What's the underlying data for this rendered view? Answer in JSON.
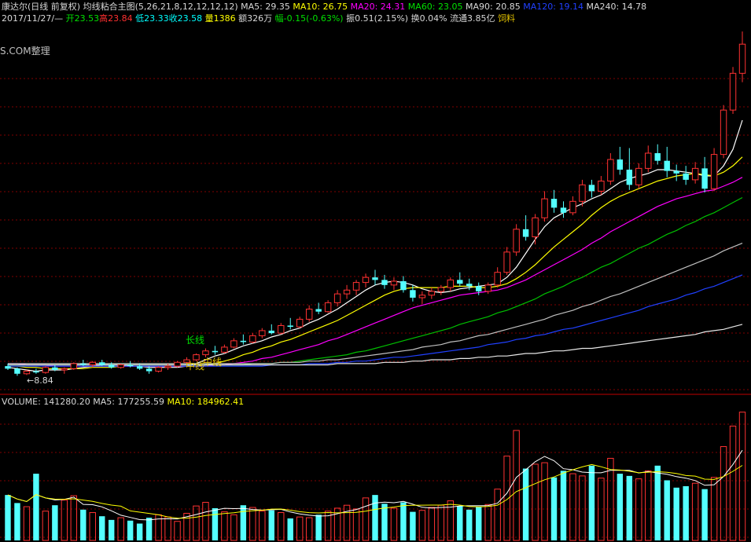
{
  "header": {
    "stock_name": "康达尔(日线 前复权)",
    "indicator": "均线粘合主图(5,26,21,8,12,12,12,12)",
    "ma5": "MA5: 29.35",
    "ma10": "MA10: 26.75",
    "ma20": "MA20: 24.31",
    "ma60": "MA60: 23.05",
    "ma90": "MA90: 20.85",
    "ma120": "MA120: 19.14",
    "ma240": "MA240: 14.78"
  },
  "quote": {
    "date": "2017/11/27/—",
    "open": "开23.53",
    "high": "高23.84",
    "low": "低23.33",
    "close": "收23.58",
    "volume": "量1386",
    "amount": "额326万",
    "change": "幅-0.15(-0.63%)",
    "amplitude": "振0.51(2.15%)",
    "turnover": "换0.04%",
    "float_cap": "流通3.85亿",
    "sector": "饲料"
  },
  "watermark": "S.COM整理",
  "annotations": {
    "long_line": "长线",
    "mid_line_1": "中线",
    "mid_line_2": "中线",
    "low_marker": "←8.84"
  },
  "volume_header": {
    "volume": "VOLUME: 141280.20",
    "ma5": "MA5: 177255.59",
    "ma10": "MA10: 184962.41"
  },
  "colors": {
    "background": "#000000",
    "up": "#ff3232",
    "down": "#54ffff",
    "ma5": "#ffffff",
    "ma10": "#ffff00",
    "ma20": "#ff00ff",
    "ma60": "#00c000",
    "ma90": "#c0c0c0",
    "ma120": "#2040ff",
    "ma240": "#e8e8e8",
    "grid": "#800000"
  },
  "chart_data": {
    "type": "candlestick",
    "ylim": [
      7.5,
      36.5
    ],
    "candles": [
      [
        9.6,
        9.8,
        9.3,
        9.4
      ],
      [
        9.4,
        9.5,
        8.84,
        9.0
      ],
      [
        9.0,
        9.3,
        8.9,
        9.2
      ],
      [
        9.2,
        9.4,
        9.0,
        9.1
      ],
      [
        9.1,
        9.6,
        9.0,
        9.5
      ],
      [
        9.5,
        9.7,
        9.2,
        9.3
      ],
      [
        9.3,
        9.5,
        9.0,
        9.4
      ],
      [
        9.4,
        9.9,
        9.3,
        9.8
      ],
      [
        9.8,
        10.1,
        9.6,
        9.7
      ],
      [
        9.7,
        10.0,
        9.5,
        9.9
      ],
      [
        9.9,
        10.1,
        9.6,
        9.7
      ],
      [
        9.7,
        9.9,
        9.4,
        9.5
      ],
      [
        9.5,
        9.8,
        9.4,
        9.7
      ],
      [
        9.7,
        10.0,
        9.5,
        9.6
      ],
      [
        9.6,
        9.8,
        9.3,
        9.4
      ],
      [
        9.4,
        9.6,
        9.0,
        9.2
      ],
      [
        9.2,
        9.6,
        9.1,
        9.5
      ],
      [
        9.5,
        9.8,
        9.3,
        9.6
      ],
      [
        9.6,
        10.0,
        9.5,
        9.9
      ],
      [
        9.9,
        10.3,
        9.7,
        10.1
      ],
      [
        10.1,
        10.6,
        10.0,
        10.5
      ],
      [
        10.5,
        11.0,
        10.3,
        10.8
      ],
      [
        10.8,
        11.2,
        10.5,
        10.7
      ],
      [
        10.7,
        11.3,
        10.6,
        11.1
      ],
      [
        11.1,
        11.8,
        11.0,
        11.6
      ],
      [
        11.6,
        12.1,
        11.3,
        11.5
      ],
      [
        11.5,
        12.2,
        11.4,
        12.0
      ],
      [
        12.0,
        12.6,
        11.8,
        12.4
      ],
      [
        12.4,
        12.9,
        12.1,
        12.2
      ],
      [
        12.2,
        13.0,
        12.1,
        12.8
      ],
      [
        12.8,
        13.4,
        12.5,
        12.7
      ],
      [
        12.7,
        13.5,
        12.6,
        13.3
      ],
      [
        13.3,
        14.4,
        13.1,
        14.1
      ],
      [
        14.1,
        14.6,
        13.7,
        13.9
      ],
      [
        13.9,
        14.8,
        13.8,
        14.6
      ],
      [
        14.6,
        15.6,
        14.3,
        15.3
      ],
      [
        15.3,
        16.0,
        14.9,
        15.6
      ],
      [
        15.6,
        16.4,
        15.2,
        16.2
      ],
      [
        16.2,
        16.9,
        15.8,
        16.6
      ],
      [
        16.6,
        17.2,
        16.0,
        16.4
      ],
      [
        16.4,
        16.8,
        15.7,
        16.0
      ],
      [
        16.0,
        16.6,
        15.6,
        16.3
      ],
      [
        16.3,
        16.7,
        15.4,
        15.6
      ],
      [
        15.6,
        16.0,
        14.7,
        15.0
      ],
      [
        15.0,
        15.5,
        14.5,
        15.2
      ],
      [
        15.2,
        15.8,
        14.9,
        15.5
      ],
      [
        15.5,
        16.0,
        15.2,
        15.8
      ],
      [
        15.8,
        16.6,
        15.5,
        16.4
      ],
      [
        16.4,
        17.0,
        15.9,
        16.1
      ],
      [
        16.1,
        16.5,
        15.6,
        15.9
      ],
      [
        15.9,
        16.2,
        15.2,
        15.5
      ],
      [
        15.5,
        16.2,
        15.3,
        16.0
      ],
      [
        16.0,
        17.4,
        15.8,
        17.0
      ],
      [
        17.0,
        19.0,
        16.8,
        18.6
      ],
      [
        18.6,
        20.8,
        18.3,
        20.4
      ],
      [
        20.4,
        21.5,
        19.5,
        19.8
      ],
      [
        19.8,
        21.6,
        19.2,
        21.3
      ],
      [
        21.3,
        23.4,
        21.0,
        22.8
      ],
      [
        22.8,
        23.5,
        21.7,
        22.1
      ],
      [
        22.1,
        22.6,
        21.3,
        21.7
      ],
      [
        21.7,
        23.0,
        21.5,
        22.6
      ],
      [
        22.6,
        24.3,
        22.2,
        23.9
      ],
      [
        23.9,
        24.3,
        22.9,
        23.4
      ],
      [
        23.4,
        24.6,
        23.1,
        24.2
      ],
      [
        24.2,
        26.4,
        23.9,
        25.9
      ],
      [
        25.9,
        26.9,
        24.7,
        25.1
      ],
      [
        25.1,
        26.8,
        23.5,
        23.9
      ],
      [
        23.9,
        25.6,
        23.6,
        25.2
      ],
      [
        25.2,
        27.0,
        24.9,
        26.4
      ],
      [
        26.4,
        27.1,
        25.5,
        25.8
      ],
      [
        25.8,
        26.9,
        24.5,
        25.0
      ],
      [
        25.0,
        25.5,
        24.2,
        24.8
      ],
      [
        24.8,
        25.4,
        23.9,
        24.3
      ],
      [
        24.3,
        25.7,
        24.0,
        25.2
      ],
      [
        25.2,
        26.1,
        23.3,
        23.6
      ],
      [
        23.6,
        26.8,
        23.4,
        26.3
      ],
      [
        26.3,
        30.2,
        26.0,
        29.8
      ],
      [
        29.8,
        33.2,
        29.5,
        32.7
      ],
      [
        32.7,
        36.0,
        32.0,
        35.0
      ]
    ],
    "ma_lines": {
      "MA5": [
        9.5,
        9.4,
        9.3,
        9.2,
        9.3,
        9.3,
        9.3,
        9.4,
        9.5,
        9.6,
        9.7,
        9.7,
        9.7,
        9.6,
        9.6,
        9.5,
        9.5,
        9.5,
        9.5,
        9.6,
        9.8,
        10.1,
        10.4,
        10.6,
        10.9,
        11.2,
        11.4,
        11.6,
        11.9,
        12.1,
        12.4,
        12.6,
        13.0,
        13.3,
        13.7,
        14.1,
        14.6,
        15.1,
        15.6,
        16.0,
        16.2,
        16.3,
        16.2,
        16.0,
        15.7,
        15.5,
        15.4,
        15.5,
        15.7,
        15.8,
        15.9,
        16.0,
        16.1,
        16.6,
        17.4,
        18.5,
        19.6,
        20.6,
        21.3,
        21.7,
        22.1,
        22.4,
        22.8,
        23.1,
        23.6,
        24.1,
        24.4,
        24.6,
        24.8,
        25.1,
        25.1,
        25.0,
        24.9,
        24.8,
        24.6,
        24.6,
        25.4,
        26.7,
        29.0
      ],
      "MA10": [
        9.6,
        9.6,
        9.5,
        9.5,
        9.4,
        9.4,
        9.4,
        9.4,
        9.4,
        9.5,
        9.5,
        9.5,
        9.6,
        9.6,
        9.6,
        9.6,
        9.6,
        9.6,
        9.6,
        9.6,
        9.6,
        9.7,
        9.8,
        10.0,
        10.2,
        10.5,
        10.7,
        11.0,
        11.2,
        11.5,
        11.7,
        12.0,
        12.3,
        12.6,
        12.9,
        13.2,
        13.6,
        14.0,
        14.4,
        14.8,
        15.2,
        15.5,
        15.7,
        15.8,
        15.8,
        15.8,
        15.8,
        15.9,
        15.9,
        15.9,
        15.8,
        15.8,
        15.9,
        16.1,
        16.5,
        17.0,
        17.6,
        18.3,
        19.0,
        19.6,
        20.2,
        20.8,
        21.5,
        22.1,
        22.6,
        23.0,
        23.3,
        23.6,
        23.9,
        24.2,
        24.4,
        24.6,
        24.7,
        24.8,
        24.7,
        24.6,
        24.9,
        25.4,
        26.1
      ],
      "MA20": [
        9.8,
        9.8,
        9.7,
        9.7,
        9.7,
        9.6,
        9.6,
        9.6,
        9.6,
        9.6,
        9.6,
        9.6,
        9.6,
        9.6,
        9.6,
        9.6,
        9.6,
        9.6,
        9.6,
        9.6,
        9.6,
        9.6,
        9.7,
        9.7,
        9.8,
        9.9,
        10.0,
        10.2,
        10.3,
        10.5,
        10.7,
        10.9,
        11.1,
        11.3,
        11.6,
        11.8,
        12.1,
        12.4,
        12.7,
        13.0,
        13.3,
        13.6,
        13.9,
        14.2,
        14.4,
        14.6,
        14.8,
        15.0,
        15.2,
        15.3,
        15.4,
        15.5,
        15.6,
        15.8,
        16.1,
        16.4,
        16.8,
        17.2,
        17.6,
        18.0,
        18.4,
        18.8,
        19.3,
        19.7,
        20.2,
        20.6,
        21.0,
        21.4,
        21.8,
        22.2,
        22.5,
        22.8,
        23.0,
        23.2,
        23.4,
        23.5,
        23.8,
        24.1,
        24.5
      ],
      "MA60": [
        9.7,
        9.7,
        9.7,
        9.7,
        9.7,
        9.7,
        9.7,
        9.7,
        9.7,
        9.7,
        9.7,
        9.7,
        9.7,
        9.7,
        9.7,
        9.7,
        9.7,
        9.7,
        9.7,
        9.7,
        9.7,
        9.7,
        9.7,
        9.7,
        9.7,
        9.7,
        9.8,
        9.8,
        9.8,
        9.9,
        9.9,
        10.0,
        10.1,
        10.2,
        10.3,
        10.4,
        10.5,
        10.7,
        10.8,
        11.0,
        11.2,
        11.4,
        11.6,
        11.8,
        12.0,
        12.2,
        12.4,
        12.6,
        12.9,
        13.1,
        13.3,
        13.5,
        13.8,
        14.0,
        14.3,
        14.6,
        14.9,
        15.3,
        15.6,
        15.9,
        16.3,
        16.6,
        17.0,
        17.4,
        17.7,
        18.1,
        18.5,
        18.9,
        19.2,
        19.6,
        20.0,
        20.3,
        20.7,
        21.0,
        21.4,
        21.7,
        22.1,
        22.5,
        22.9
      ],
      "MA90": [
        9.8,
        9.8,
        9.8,
        9.8,
        9.8,
        9.8,
        9.8,
        9.8,
        9.8,
        9.8,
        9.8,
        9.8,
        9.8,
        9.8,
        9.8,
        9.8,
        9.8,
        9.8,
        9.8,
        9.8,
        9.8,
        9.8,
        9.8,
        9.8,
        9.8,
        9.8,
        9.8,
        9.8,
        9.8,
        9.9,
        9.9,
        9.9,
        10.0,
        10.0,
        10.1,
        10.1,
        10.2,
        10.3,
        10.4,
        10.5,
        10.6,
        10.7,
        10.8,
        10.9,
        11.1,
        11.2,
        11.3,
        11.5,
        11.6,
        11.8,
        12.0,
        12.1,
        12.3,
        12.5,
        12.7,
        12.9,
        13.1,
        13.3,
        13.6,
        13.8,
        14.0,
        14.3,
        14.5,
        14.8,
        15.1,
        15.3,
        15.6,
        15.9,
        16.2,
        16.5,
        16.8,
        17.1,
        17.4,
        17.7,
        18.0,
        18.3,
        18.7,
        19.0,
        19.3
      ],
      "MA120": [
        9.6,
        9.6,
        9.6,
        9.6,
        9.6,
        9.6,
        9.6,
        9.6,
        9.6,
        9.6,
        9.6,
        9.6,
        9.6,
        9.6,
        9.6,
        9.6,
        9.6,
        9.6,
        9.6,
        9.6,
        9.6,
        9.6,
        9.6,
        9.6,
        9.6,
        9.6,
        9.6,
        9.6,
        9.7,
        9.7,
        9.7,
        9.7,
        9.8,
        9.8,
        9.8,
        9.9,
        9.9,
        10.0,
        10.0,
        10.1,
        10.2,
        10.3,
        10.3,
        10.4,
        10.5,
        10.6,
        10.7,
        10.8,
        10.9,
        11.0,
        11.1,
        11.3,
        11.4,
        11.5,
        11.7,
        11.8,
        12.0,
        12.1,
        12.3,
        12.5,
        12.6,
        12.8,
        13.0,
        13.2,
        13.4,
        13.6,
        13.8,
        14.0,
        14.3,
        14.5,
        14.7,
        14.9,
        15.2,
        15.4,
        15.7,
        15.9,
        16.2,
        16.5,
        16.8
      ],
      "MA240": [
        9.7,
        9.7,
        9.7,
        9.7,
        9.7,
        9.7,
        9.7,
        9.7,
        9.7,
        9.7,
        9.7,
        9.7,
        9.7,
        9.7,
        9.7,
        9.7,
        9.7,
        9.7,
        9.7,
        9.7,
        9.7,
        9.7,
        9.7,
        9.7,
        9.7,
        9.7,
        9.7,
        9.7,
        9.7,
        9.7,
        9.7,
        9.7,
        9.7,
        9.7,
        9.7,
        9.8,
        9.8,
        9.8,
        9.8,
        9.8,
        9.9,
        9.9,
        9.9,
        10.0,
        10.0,
        10.1,
        10.1,
        10.1,
        10.2,
        10.2,
        10.3,
        10.3,
        10.4,
        10.4,
        10.5,
        10.6,
        10.6,
        10.7,
        10.8,
        10.8,
        10.9,
        11.0,
        11.0,
        11.1,
        11.2,
        11.3,
        11.4,
        11.5,
        11.6,
        11.7,
        11.8,
        11.9,
        12.0,
        12.1,
        12.3,
        12.4,
        12.5,
        12.7,
        12.9
      ]
    },
    "volume_ylim": [
      0,
      180000
    ],
    "volume": [
      62000,
      51000,
      46000,
      91000,
      40000,
      48000,
      55000,
      61000,
      42000,
      38000,
      33000,
      28000,
      31000,
      27000,
      23000,
      31000,
      35000,
      32000,
      26000,
      37000,
      47000,
      52000,
      44000,
      39000,
      35000,
      48000,
      45000,
      40000,
      41000,
      38000,
      30000,
      32000,
      31000,
      35000,
      40000,
      44000,
      48000,
      43000,
      58000,
      62000,
      50000,
      44000,
      52000,
      39000,
      41000,
      45000,
      48000,
      54000,
      47000,
      42000,
      46000,
      49000,
      70000,
      115000,
      150000,
      98000,
      104000,
      106000,
      86000,
      95000,
      91000,
      88000,
      102000,
      85000,
      112000,
      91000,
      88000,
      84000,
      95000,
      102000,
      82000,
      72000,
      74000,
      78000,
      70000,
      86000,
      128000,
      156000,
      175000
    ]
  }
}
